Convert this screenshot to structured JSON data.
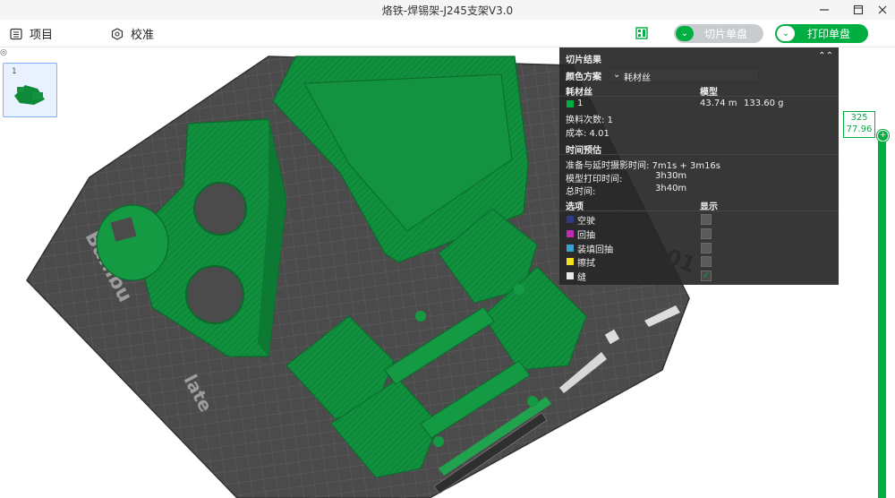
{
  "window": {
    "title": "烙铁-焊锡架-J245支架V3.0",
    "minimize_icon": "minimize-icon",
    "maximize_icon": "maximize-icon",
    "close_icon": "close-icon"
  },
  "toolbar": {
    "project_label": "项目",
    "calibrate_label": "校准",
    "slice_button": "切片单盘",
    "print_button": "打印单盘"
  },
  "plate": {
    "thumbnail_number": "1"
  },
  "slice_panel": {
    "header": "切片结果",
    "color_scheme_label": "颜色方案",
    "color_scheme_value": "耗材丝",
    "filament_col": "耗材丝",
    "model_col": "模型",
    "filament_id": "1",
    "filament_length": "43.74 m",
    "filament_weight": "133.60 g",
    "filament_color": "#00ae42",
    "change_count": "换料次数: 1",
    "cost": "成本: 4.01",
    "time_header": "时间预估",
    "prep_time": "准备与延时摄影时间: 7m1s + 3m16s",
    "model_print_label": "模型打印时间:",
    "model_print_value": "3h30m",
    "total_label": "总时间:",
    "total_value": "3h40m",
    "options_header": "选项",
    "display_header": "显示",
    "options": [
      {
        "label": "空驶",
        "color": "#2d3a8c",
        "checked": false
      },
      {
        "label": "回抽",
        "color": "#c02ab8",
        "checked": false
      },
      {
        "label": "装填回抽",
        "color": "#3aa0d8",
        "checked": false
      },
      {
        "label": "擦拭",
        "color": "#f2e21c",
        "checked": false
      },
      {
        "label": "缝",
        "color": "#e8e8e8",
        "checked": true
      }
    ]
  },
  "layer_slider": {
    "layer": "325",
    "height": "77.96"
  },
  "bed": {
    "brand_text": "Bambu",
    "plate_text": "late",
    "plate_number": "01"
  }
}
